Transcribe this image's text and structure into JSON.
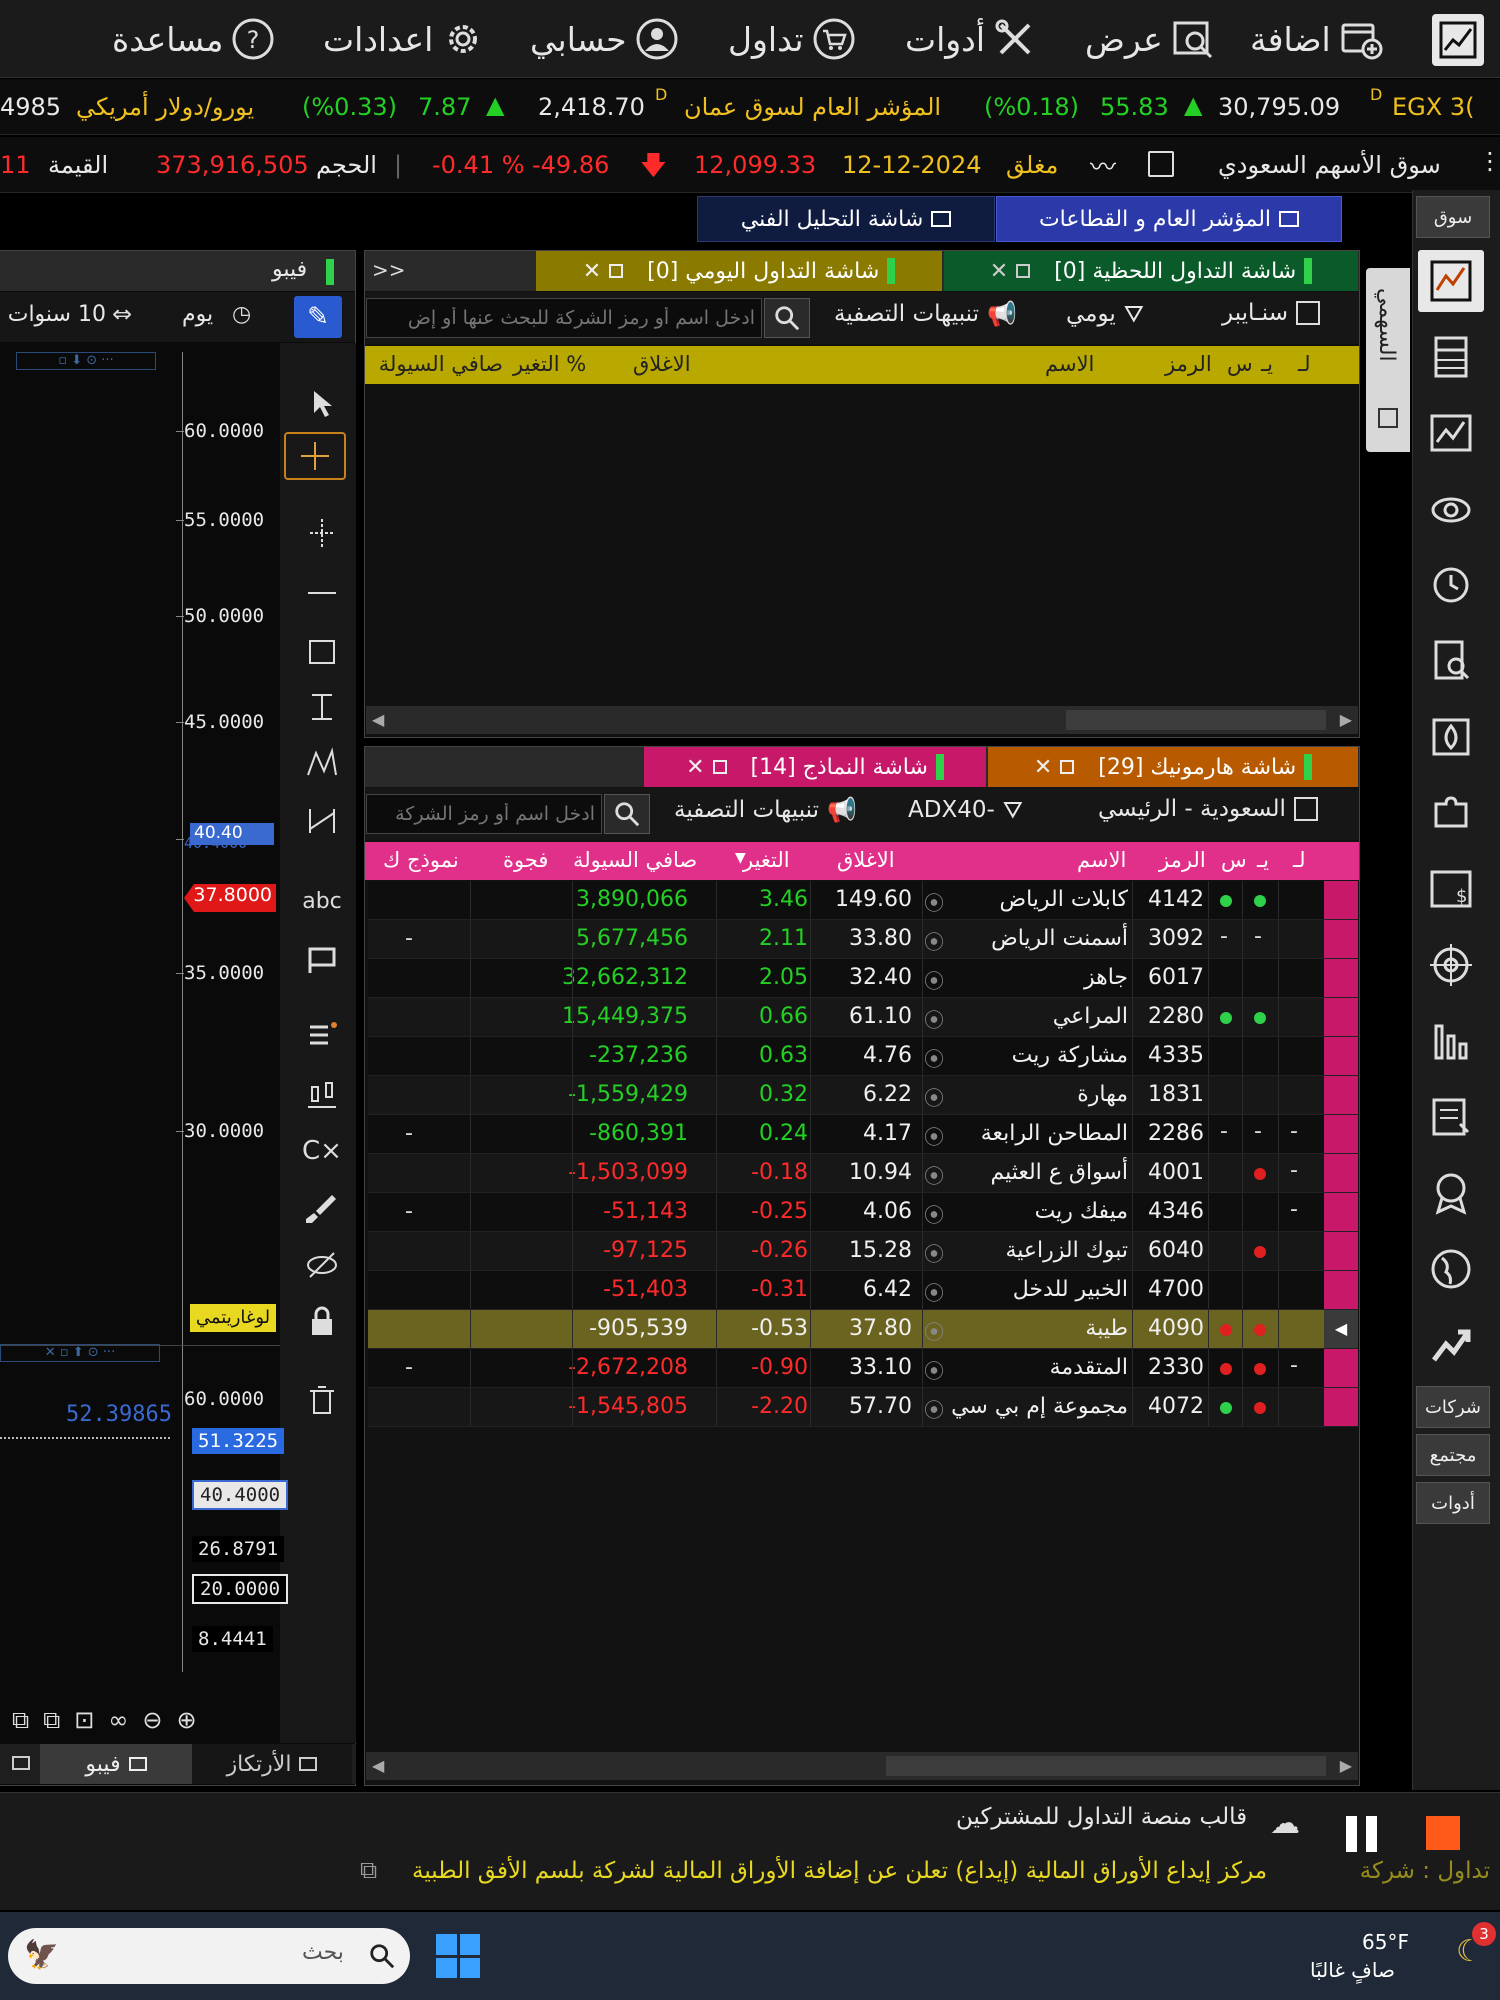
{
  "menu": {
    "items": [
      {
        "label": "اضافة",
        "icon": "add-window-icon"
      },
      {
        "label": "عرض",
        "icon": "view-search-icon"
      },
      {
        "label": "أدوات",
        "icon": "tools-icon"
      },
      {
        "label": "تداول",
        "icon": "cart-icon"
      },
      {
        "label": "حسابي",
        "icon": "user-icon"
      },
      {
        "label": "اعدادات",
        "icon": "gear-icon"
      },
      {
        "label": "مساعدة",
        "icon": "help-icon"
      }
    ]
  },
  "ticker1": {
    "egx_name": "EGX 3(",
    "egx_marker": "D",
    "egx_value": "30,795.09",
    "egx_change": "55.83",
    "egx_pct": "(%0.18)",
    "msx_name": "المؤشر العام لسوق عمان",
    "msx_marker": "D",
    "msx_value": "2,418.70",
    "msx_change": "7.87",
    "msx_pct": "(%0.33)",
    "fx_name": "يورو/دولار أمريكي",
    "fx_value": "4985"
  },
  "ticker2": {
    "market": "سوق الأسهم السعودي",
    "status": "مغلق",
    "date": "12-12-2024",
    "value": "12,099.33",
    "change": "-49.86",
    "pct": "-0.41 %",
    "volume_label": "الحجم",
    "volume": "373,916,505",
    "turnover_label": "القيمة",
    "turnover_tail": "11"
  },
  "top_tabs": {
    "general": "المؤشر العام و القطاعات",
    "technical": "شاشة التحليل الفني"
  },
  "sidebar": {
    "market_label": "سوق",
    "companies": "شركات",
    "community": "مجتمع",
    "tools": "أدوات",
    "watchlist_vertical": "السهمي"
  },
  "upper_panel": {
    "tabs": [
      {
        "label": "شاشة التداول اللحظية [0]",
        "color": "#0a5a2a"
      },
      {
        "label": "شاشة التداول اليومي [0]",
        "color": "#8a7a00"
      }
    ],
    "more": ">>",
    "toolbar": {
      "scanner": "سنـايبر",
      "daily": "يومي",
      "alerts": "تنبيهات التصفية",
      "search_placeholder": "ادخل اسم أو رمز الشركة للبحث عنها أو إض"
    },
    "headers": [
      "لـ",
      "يـ",
      "س",
      "الرمز",
      "الاسم",
      "الاغلاق",
      "التغير %",
      "صافي السيولة"
    ]
  },
  "lower_panel": {
    "tabs": [
      {
        "label": "شاشة هارمونيك [29]",
        "color": "#b85a00"
      },
      {
        "label": "شاشة النماذج [14]",
        "color": "#c8186a"
      }
    ],
    "toolbar": {
      "market": "السعودية - الرئيسي",
      "filter": "ADX40-",
      "alerts": "تنبيهات التصفية",
      "search_placeholder": "ادخل اسم أو رمز الشركة"
    },
    "headers": [
      "لـ",
      "يـ",
      "س",
      "الرمز",
      "الاسم",
      "الاغلاق",
      "التغير",
      "صافي السيولة",
      "فجوة",
      "نموذج ك"
    ],
    "rows": [
      {
        "l": "",
        "y": "green",
        "s": "green",
        "sym": "4142",
        "name": "كابلات الرياض",
        "close": "149.60",
        "chg": "3.46",
        "liq": "3,890,066",
        "gap": "",
        "model": "",
        "up": true,
        "sel": false
      },
      {
        "l": "",
        "y": "-",
        "s": "-",
        "sym": "3092",
        "name": "أسمنت الرياض",
        "close": "33.80",
        "chg": "2.11",
        "liq": "5,677,456",
        "gap": "",
        "model": "-",
        "up": true,
        "sel": false
      },
      {
        "l": "",
        "y": "",
        "s": "",
        "sym": "6017",
        "name": "جاهز",
        "close": "32.40",
        "chg": "2.05",
        "liq": "32,662,312",
        "gap": "",
        "model": "",
        "up": true,
        "sel": false
      },
      {
        "l": "",
        "y": "green",
        "s": "green",
        "sym": "2280",
        "name": "المراعي",
        "close": "61.10",
        "chg": "0.66",
        "liq": "15,449,375",
        "gap": "",
        "model": "",
        "up": true,
        "sel": false
      },
      {
        "l": "",
        "y": "",
        "s": "",
        "sym": "4335",
        "name": "مشاركة ريت",
        "close": "4.76",
        "chg": "0.63",
        "liq": "237,236-",
        "gap": "",
        "model": "",
        "up": true,
        "sel": false
      },
      {
        "l": "",
        "y": "",
        "s": "",
        "sym": "1831",
        "name": "مهارة",
        "close": "6.22",
        "chg": "0.32",
        "liq": "1,559,429-",
        "gap": "",
        "model": "",
        "up": true,
        "sel": false
      },
      {
        "l": "-",
        "y": "-",
        "s": "-",
        "sym": "2286",
        "name": "المطاحن الرابعة",
        "close": "4.17",
        "chg": "0.24",
        "liq": "860,391-",
        "gap": "",
        "model": "-",
        "up": true,
        "sel": false
      },
      {
        "l": "-",
        "y": "red",
        "s": "",
        "sym": "4001",
        "name": "أسواق ع العثيم",
        "close": "10.94",
        "chg": "0.18-",
        "liq": "1,503,099-",
        "gap": "",
        "model": "",
        "up": false,
        "sel": false
      },
      {
        "l": "-",
        "y": "",
        "s": "",
        "sym": "4346",
        "name": "ميفك ريت",
        "close": "4.06",
        "chg": "0.25-",
        "liq": "51,143-",
        "gap": "",
        "model": "-",
        "up": false,
        "sel": false
      },
      {
        "l": "",
        "y": "red",
        "s": "",
        "sym": "6040",
        "name": "تبوك الزراعية",
        "close": "15.28",
        "chg": "0.26-",
        "liq": "97,125-",
        "gap": "",
        "model": "",
        "up": false,
        "sel": false
      },
      {
        "l": "",
        "y": "",
        "s": "",
        "sym": "4700",
        "name": "الخبير للدخل",
        "close": "6.42",
        "chg": "0.31-",
        "liq": "51,403-",
        "gap": "",
        "model": "",
        "up": false,
        "sel": false
      },
      {
        "l": "",
        "y": "red",
        "s": "red",
        "sym": "4090",
        "name": "طيبة",
        "close": "37.80",
        "chg": "0.53-",
        "liq": "905,539-",
        "gap": "",
        "model": "",
        "up": false,
        "sel": true
      },
      {
        "l": "-",
        "y": "red",
        "s": "red",
        "sym": "2330",
        "name": "المتقدمة",
        "close": "33.10",
        "chg": "0.90-",
        "liq": "2,672,208-",
        "gap": "",
        "model": "-",
        "up": false,
        "sel": false
      },
      {
        "l": "",
        "y": "red",
        "s": "green",
        "sym": "4072",
        "name": "مجموعة إم بي سي",
        "close": "57.70",
        "chg": "2.20-",
        "liq": "1,545,805-",
        "gap": "",
        "model": "",
        "up": false,
        "sel": false
      }
    ]
  },
  "chart_panel": {
    "title": "فيبو",
    "period": "يوم",
    "range": "10 سنوات",
    "price_labels": [
      "60.0000",
      "55.0000",
      "50.0000",
      "45.0000",
      "40.4000",
      "37.8000",
      "35.0000",
      "30.0000"
    ],
    "current_price": "37.8000",
    "fib_level": "40.40",
    "log_label": "لوغاريتمي",
    "indicator_labels": [
      "60.0000",
      "52.39865",
      "51.3225",
      "40.4000",
      "26.8791",
      "20.0000",
      "8.4441"
    ],
    "bottom_tabs": [
      "الأرتكاز",
      "فيبو"
    ]
  },
  "footer": {
    "template_text": "قالب منصة التداول للمشتركين",
    "news_prefix": "تداول : شركة",
    "news_text": "مركز إيداع الأوراق المالية (إيداع) تعلن عن إضافة الأوراق المالية لشركة بلسم الأفق الطبية"
  },
  "taskbar": {
    "search_placeholder": "بحث",
    "temperature": "65°F",
    "weather": "صافٍ غالبًا",
    "notification_count": "3"
  },
  "colors": {
    "green": "#24d024",
    "red": "#ff2a2a",
    "yellow_header": "#b8a800",
    "pink_header": "#e0308a",
    "selected_row": "#6b6420"
  }
}
